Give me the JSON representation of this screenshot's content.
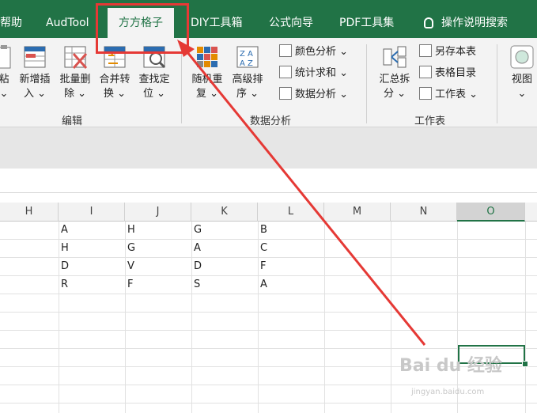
{
  "tabs": [
    {
      "label": "帮助"
    },
    {
      "label": "AudTool"
    },
    {
      "label": "方方格子",
      "active": true
    },
    {
      "label": "DIY工具箱"
    },
    {
      "label": "公式向导"
    },
    {
      "label": "PDF工具集"
    }
  ],
  "tell_me": "操作说明搜索",
  "ribbon": {
    "edit_group": {
      "label": "编辑",
      "buttons": [
        {
          "line1": "粘",
          "line2": "⌄"
        },
        {
          "line1": "新增插",
          "line2": "入 ⌄"
        },
        {
          "line1": "批量删",
          "line2": "除 ⌄"
        },
        {
          "line1": "合并转",
          "line2": "换 ⌄"
        },
        {
          "line1": "查找定",
          "line2": "位 ⌄"
        }
      ]
    },
    "data_group": {
      "label": "数据分析",
      "buttons": [
        {
          "line1": "随机重",
          "line2": "复 ⌄"
        },
        {
          "line1": "高级排",
          "line2": "序 ⌄"
        }
      ],
      "small": [
        "颜色分析 ⌄",
        "统计求和 ⌄",
        "数据分析 ⌄"
      ]
    },
    "sheet_group": {
      "label": "工作表",
      "button": {
        "line1": "汇总拆",
        "line2": "分 ⌄"
      },
      "small": [
        "另存本表",
        "表格目录",
        "工作表 ⌄"
      ]
    },
    "view": {
      "line1": "视图",
      "line2": "⌄"
    }
  },
  "columns": [
    "H",
    "I",
    "J",
    "K",
    "L",
    "M",
    "N",
    "O"
  ],
  "cells": {
    "I": [
      "A",
      "H",
      "D",
      "R"
    ],
    "J": [
      "H",
      "G",
      "V",
      "F"
    ],
    "K": [
      "G",
      "A",
      "D",
      "S"
    ],
    "L": [
      "B",
      "C",
      "F",
      "A"
    ]
  },
  "watermark": {
    "main": "Bai du 经验",
    "sub": "jingyan.baidu.com"
  },
  "colors": {
    "accent": "#217346",
    "highlight": "#e53935"
  }
}
